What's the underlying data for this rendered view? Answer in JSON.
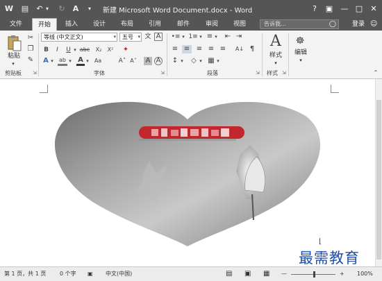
{
  "titlebar": {
    "title": "新建 Microsoft Word Document.docx - Word",
    "help": "?",
    "ribbon_display": "▣",
    "minimize": "—",
    "maximize": "□",
    "close": "✕"
  },
  "qat": {
    "word_icon": "W",
    "save_icon": "▤",
    "undo_icon": "↶",
    "redo_icon": "↻",
    "format_icon": "A",
    "customize_icon": "▾"
  },
  "tabs": [
    "文件",
    "开始",
    "插入",
    "设计",
    "布局",
    "引用",
    "邮件",
    "审阅",
    "视图"
  ],
  "active_tab": "开始",
  "tellme": {
    "placeholder": "告诉我..."
  },
  "login": "登录",
  "share_icon": "☺",
  "clipboard": {
    "paste_label": "粘贴",
    "group_label": "剪贴板",
    "cut_icon": "✂",
    "copy_icon": "❐",
    "painter_icon": "✎"
  },
  "font": {
    "font_name": "等线 (中文正文)",
    "font_size": "五号",
    "grow": "A˄",
    "shrink": "A˅",
    "change_case": "Aa",
    "clear": "A",
    "phonetic": "文",
    "border": "A",
    "bold": "B",
    "italic": "I",
    "underline": "U",
    "strike": "abc",
    "subscript": "X₂",
    "superscript": "X²",
    "effects": "A",
    "highlight": "ab",
    "color": "A",
    "shade": "A",
    "grow2": "A˄",
    "group_label": "字体"
  },
  "paragraph": {
    "group_label": "段落",
    "bullets": "•≡",
    "numbering": "1≡",
    "multilevel": "≡",
    "dec_indent": "⇤",
    "inc_indent": "⇥",
    "sort": "A↓",
    "marks": "¶",
    "align_left": "≡",
    "center": "≡",
    "align_right": "≡",
    "justify": "≡",
    "distribute": "≡",
    "spacing": "↕",
    "shading": "◇",
    "borders": "▦"
  },
  "styles": {
    "label": "样式",
    "group_label": "样式",
    "icon": "A"
  },
  "editing": {
    "label": "编辑",
    "icon": "☸"
  },
  "document": {
    "banner_alt": "pixelated red banner text",
    "image_desc": "heart shaped grey photo with lotus"
  },
  "status": {
    "page": "第 1 页，共 1 页",
    "words": "0 个字",
    "proof_icon": "▣",
    "language": "中文(中国)",
    "read_mode": "▤",
    "print_layout": "▣",
    "web_layout": "▦",
    "zoom_out": "—",
    "zoom_in": "+",
    "zoom": "100%"
  },
  "watermark": "最需教育"
}
